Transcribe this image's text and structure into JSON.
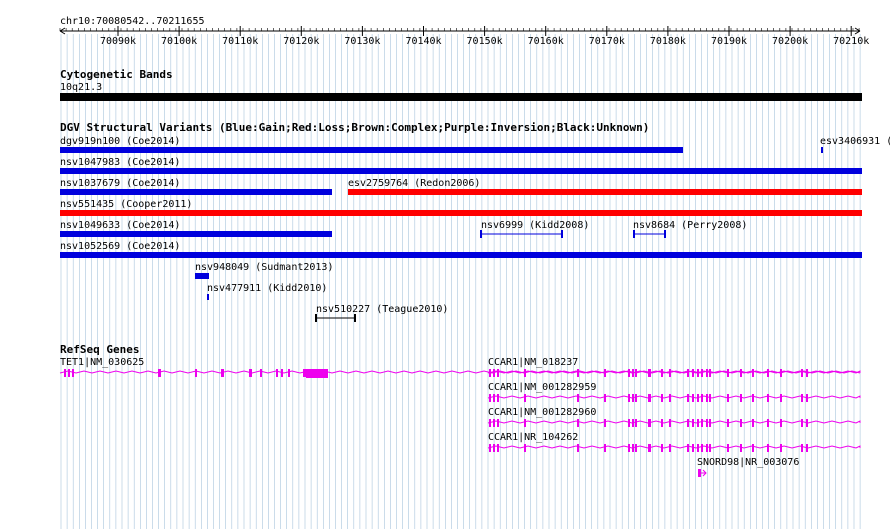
{
  "ruler": {
    "position": "chr10:70080542..70211655",
    "ticks": [
      "70090k",
      "70100k",
      "70110k",
      "70120k",
      "70130k",
      "70140k",
      "70150k",
      "70160k",
      "70170k",
      "70180k",
      "70190k",
      "70200k",
      "70210k"
    ]
  },
  "cyto": {
    "title": "Cytogenetic Bands",
    "band": "10q21.3"
  },
  "dgv": {
    "title": "DGV Structural Variants (Blue:Gain;Red:Loss;Brown:Complex;Purple:Inversion;Black:Unknown)",
    "features": [
      {
        "label": "dgv919n100 (Coe2014)",
        "color": "blue"
      },
      {
        "label": "esv3406931 (",
        "color": "blue"
      },
      {
        "label": "nsv1047983 (Coe2014)",
        "color": "blue"
      },
      {
        "label": "nsv1037679 (Coe2014)",
        "color": "blue"
      },
      {
        "label": "esv2759764 (Redon2006)",
        "color": "red"
      },
      {
        "label": "nsv551435 (Cooper2011)",
        "color": "red"
      },
      {
        "label": "nsv1049633 (Coe2014)",
        "color": "blue"
      },
      {
        "label": "nsv6999 (Kidd2008)",
        "color": "blue"
      },
      {
        "label": "nsv8684 (Perry2008)",
        "color": "blue"
      },
      {
        "label": "nsv1052569 (Coe2014)",
        "color": "blue"
      },
      {
        "label": "nsv948049 (Sudmant2013)",
        "color": "blue"
      },
      {
        "label": "nsv477911 (Kidd2010)",
        "color": "blue"
      },
      {
        "label": "nsv510227 (Teague2010)",
        "color": "black"
      }
    ]
  },
  "refseq": {
    "title": "RefSeq Genes",
    "genes": [
      "TET1|NM_030625",
      "CCAR1|NM_018237",
      "CCAR1|NM_001282959",
      "CCAR1|NM_001282960",
      "CCAR1|NR_104262",
      "SNORD98|NR_003076"
    ]
  },
  "colors": {
    "gain": "#0000dd",
    "loss": "#ff0000",
    "unknown": "#000000",
    "gene": "#ee00ee",
    "grid": "#a8c4dc",
    "cytoband": "#000000"
  }
}
